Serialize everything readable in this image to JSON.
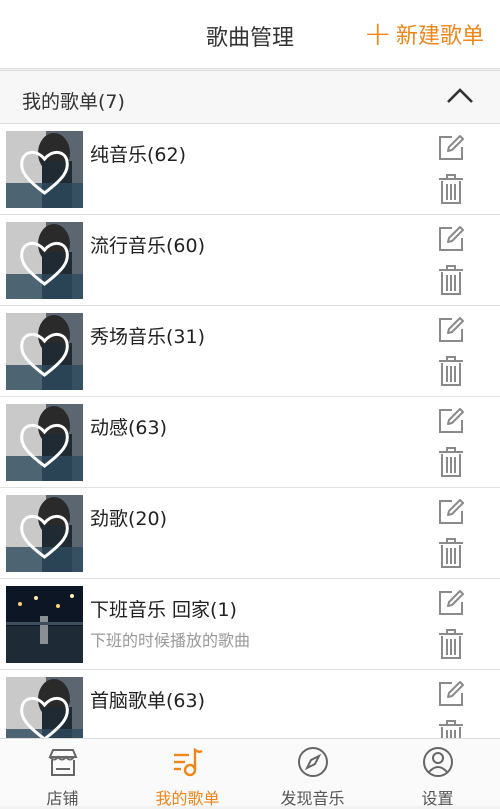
{
  "header": {
    "title": "歌曲管理",
    "new_label": "新建歌单",
    "accent": "#f08519"
  },
  "section": {
    "label": "我的歌单(7)"
  },
  "playlists": [
    {
      "title": "纯音乐(62)",
      "subtitle": "",
      "thumb": "heart"
    },
    {
      "title": "流行音乐(60)",
      "subtitle": "",
      "thumb": "heart"
    },
    {
      "title": "秀场音乐(31)",
      "subtitle": "",
      "thumb": "heart"
    },
    {
      "title": "动感(63)",
      "subtitle": "",
      "thumb": "heart"
    },
    {
      "title": "劲歌(20)",
      "subtitle": "",
      "thumb": "heart"
    },
    {
      "title": "下班音乐 回家(1)",
      "subtitle": "下班的时候播放的歌曲",
      "thumb": "night"
    },
    {
      "title": "首脑歌单(63)",
      "subtitle": "",
      "thumb": "heart"
    }
  ],
  "tabs": [
    {
      "label": "店铺",
      "icon": "store-icon",
      "active": false
    },
    {
      "label": "我的歌单",
      "icon": "music-note-icon",
      "active": true
    },
    {
      "label": "发现音乐",
      "icon": "compass-icon",
      "active": false
    },
    {
      "label": "设置",
      "icon": "profile-icon",
      "active": false
    }
  ]
}
